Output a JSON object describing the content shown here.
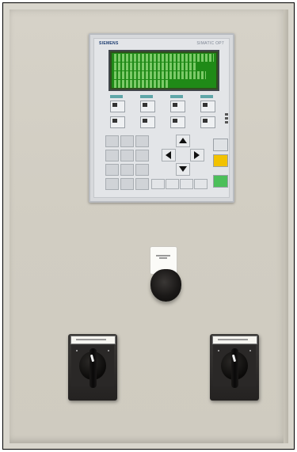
{
  "hmi": {
    "brand_left": "SIEMENS",
    "brand_right": "SIMATIC OP7",
    "display_color": "#1f8a17",
    "function_keys": 8,
    "numeric_keypad": "number-keys",
    "cursor_keys": [
      "up-arrow-icon",
      "left-arrow-icon",
      "right-arrow-icon",
      "down-arrow-icon"
    ],
    "control_key_colors": {
      "upper": "#dfe2e5",
      "middle": "#f2c200",
      "lower": "#4cbf5a"
    }
  },
  "estop": {
    "button_color": "#141212",
    "plate_color": "#fbfbf8"
  },
  "switches": [
    {
      "name": "left",
      "handle_color": "#0b0a09"
    },
    {
      "name": "right",
      "handle_color": "#0b0a09"
    }
  ],
  "colors": {
    "cabinet": "#d3cfc4",
    "panel_frame": "#d7d9dc"
  }
}
